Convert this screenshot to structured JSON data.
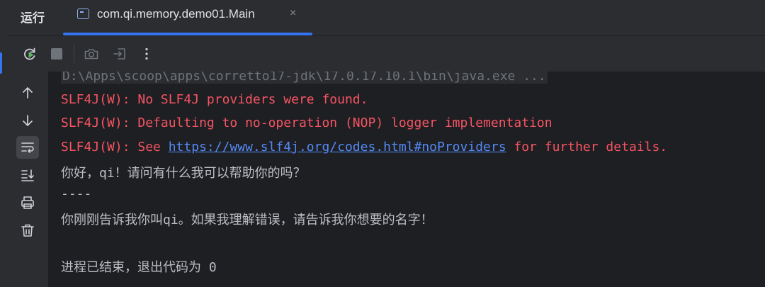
{
  "run_panel": {
    "title": "运行",
    "tab": {
      "label": "com.qi.memory.demo01.Main",
      "close_glyph": "×"
    }
  },
  "toolbar": {
    "icons": [
      "rerun-icon",
      "stop-icon",
      "camera-icon",
      "exit-icon",
      "more-icon"
    ]
  },
  "sidebar": {
    "icons": [
      "up-arrow-icon",
      "down-arrow-icon",
      "soft-wrap-icon",
      "scroll-to-end-icon",
      "print-icon",
      "trash-icon"
    ]
  },
  "console": {
    "command": "D:\\Apps\\scoop\\apps\\corretto17-jdk\\17.0.17.10.1\\bin\\java.exe ...",
    "slf4j_line1": "SLF4J(W): No SLF4J providers were found.",
    "slf4j_line2": "SLF4J(W): Defaulting to no-operation (NOP) logger implementation",
    "slf4j_line3_prefix": "SLF4J(W): See ",
    "slf4j_line3_link": "https://www.slf4j.org/codes.html#noProviders",
    "slf4j_line3_suffix": " for further details.",
    "output1": "你好，qi！请问有什么我可以帮助你的吗？",
    "separator": "----",
    "output2": "你刚刚告诉我你叫qi。如果我理解错误，请告诉我你想要的名字！",
    "exit_message": "进程已结束，退出代码为 0"
  },
  "colors": {
    "background": "#1e1f22",
    "panel": "#2b2d30",
    "accent": "#3574f0",
    "error_text": "#f75464",
    "link": "#548af7",
    "output_text": "#bcbec4"
  }
}
